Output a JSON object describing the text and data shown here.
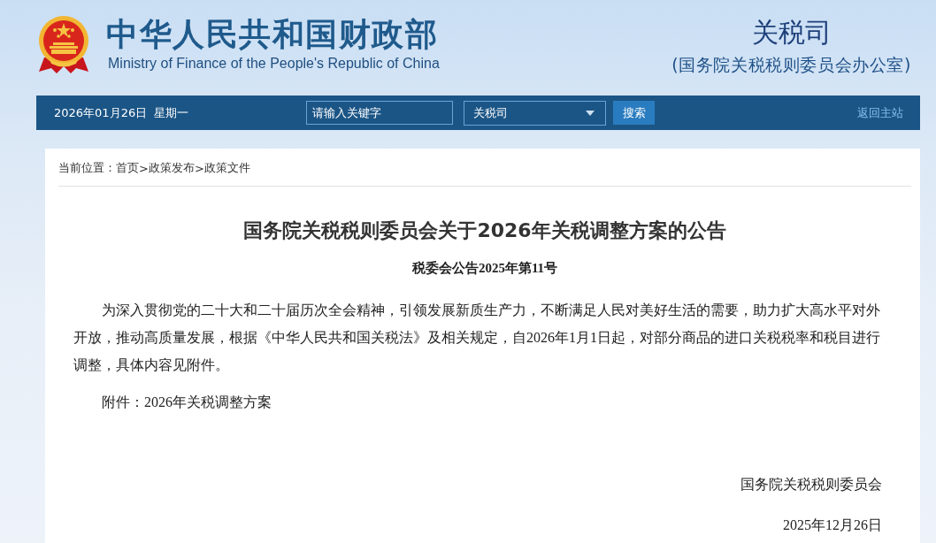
{
  "header": {
    "title": "中华人民共和国财政部",
    "subtitle": "Ministry of Finance of the People's Republic of China",
    "department": "关税司",
    "department_note": "(国务院关税税则委员会办公室)"
  },
  "navbar": {
    "date": "2026年01月26日",
    "weekday": "星期一",
    "search": {
      "placeholder": "请输入关键字"
    },
    "scope": {
      "value": "关税司"
    },
    "search_button": "搜索",
    "home_link": "返回主站"
  },
  "breadcrumb": {
    "label": "当前位置：",
    "trail": [
      {
        "text": "首页"
      },
      {
        "separator": ">",
        "text": "政策发布"
      },
      {
        "separator": ">",
        "text": "政策文件"
      }
    ]
  },
  "article": {
    "title": "国务院关税税则委员会关于2026年关税调整方案的公告",
    "number": "税委会公告2025年第11号",
    "paragraphs": [
      "为深入贯彻党的二十大和二十届历次全会精神，引领发展新质生产力，不断满足人民对美好生活的需要，助力扩大高水平对外开放，推动高质量发展，根据《中华人民共和国关税法》及相关规定，自2026年1月1日起，对部分商品的进口关税税率和税目进行调整，具体内容见附件。"
    ],
    "attachment": "附件：2026年关税调整方案",
    "signature": "国务院关税税则委员会",
    "date": "2025年12月26日"
  }
}
